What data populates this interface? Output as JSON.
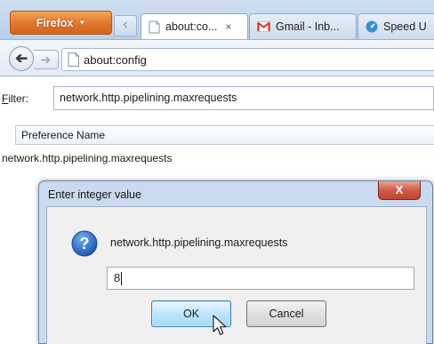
{
  "browser": {
    "app_button_label": "Firefox",
    "tabs": [
      {
        "label": "about:co...",
        "close": "×",
        "icon": "page-icon",
        "active": true
      },
      {
        "label": "Gmail - Inb...",
        "icon": "gmail-icon",
        "active": false
      },
      {
        "label": "Speed U",
        "icon": "speed-icon",
        "active": false
      }
    ],
    "url": "about:config"
  },
  "config": {
    "filter_label_prefix": "F",
    "filter_label_rest": "ilter:",
    "filter_value": "network.http.pipelining.maxrequests",
    "column_header": "Preference Name",
    "rows": [
      "network.http.pipelining.maxrequests"
    ]
  },
  "dialog": {
    "title": "Enter integer value",
    "close_label": "X",
    "message": "network.http.pipelining.maxrequests",
    "input_value": "8",
    "ok_label": "OK",
    "cancel_label": "Cancel",
    "icon": "question-icon"
  },
  "colors": {
    "firefox_button": "#e2762a",
    "dialog_frame": "#c9daee",
    "close_button": "#c0412b",
    "question_icon": "#2a6ec8",
    "gmail_red": "#d93025"
  }
}
